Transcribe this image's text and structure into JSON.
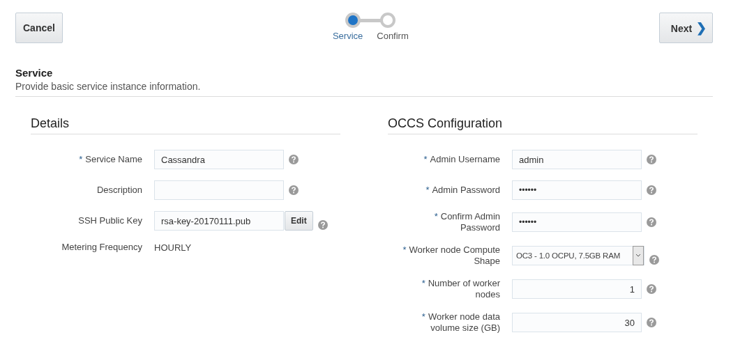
{
  "header": {
    "cancel": "Cancel",
    "next": "Next",
    "next_icon": "❯",
    "train": [
      {
        "label": "Service",
        "selected": true
      },
      {
        "label": "Confirm",
        "selected": false
      }
    ]
  },
  "section": {
    "title": "Service",
    "subtitle": "Provide basic service instance information."
  },
  "panels": [
    {
      "title": "Details",
      "fields": [
        {
          "kind": "text",
          "label": "Service Name",
          "asterisk": "*",
          "value": "Cassandra",
          "help": true
        },
        {
          "kind": "text",
          "label": "Description",
          "help": true
        },
        {
          "kind": "key",
          "label": "SSH Public Key",
          "value": "rsa-key-20170111.pub",
          "button": "Edit",
          "help": true
        },
        {
          "kind": "static",
          "label": "Metering Frequency",
          "value": "HOURLY",
          "help": false
        }
      ]
    },
    {
      "title": "OCCS Configuration",
      "fields": [
        {
          "kind": "text",
          "label": "Admin Username",
          "asterisk": "*",
          "value": "admin",
          "help": true
        },
        {
          "kind": "password",
          "label": "Admin Password",
          "asterisk": "*",
          "value": "••••••",
          "help": true
        },
        {
          "kind": "password",
          "label": "Confirm Admin Password",
          "asterisk": "*",
          "value": "••••••",
          "help": true
        },
        {
          "kind": "select",
          "label": "Worker node Compute Shape",
          "asterisk": "*",
          "value": "OC3 - 1.0 OCPU, 7.5GB RAM",
          "help": true
        },
        {
          "kind": "number",
          "label": "Number of worker nodes",
          "asterisk": "*",
          "value": "1",
          "help": true
        },
        {
          "kind": "number",
          "label": "Worker node data volume size (GB)",
          "asterisk": "*",
          "value": "30",
          "help": true
        }
      ]
    }
  ]
}
